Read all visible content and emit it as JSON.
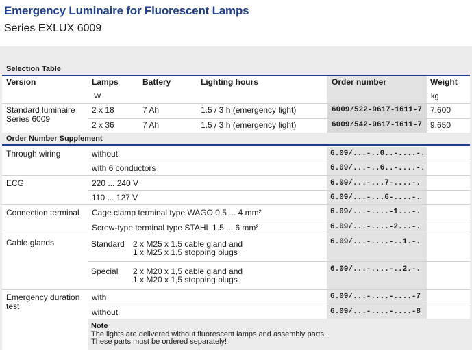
{
  "header": {
    "title": "Emergency Luminaire for Fluorescent Lamps",
    "subtitle": "Series EXLUX 6009"
  },
  "selection_table": {
    "title": "Selection Table",
    "columns": {
      "version": "Version",
      "lamps": "Lamps",
      "lamps_unit": "W",
      "battery": "Battery",
      "lighting_hours": "Lighting hours",
      "order_number": "Order number",
      "weight": "Weight",
      "weight_unit": "kg"
    },
    "version_line1": "Standard luminaire",
    "version_line2": "Series 6009",
    "rows": [
      {
        "lamps": "2 x 18",
        "battery": "7 Ah",
        "hours": "1.5 / 3 h (emergency light)",
        "order": "6009/522-9617-1611-7",
        "weight": "7.600"
      },
      {
        "lamps": "2 x 36",
        "battery": "7 Ah",
        "hours": "1.5 / 3 h (emergency light)",
        "order": "6009/542-9617-1611-7",
        "weight": "9.650"
      }
    ]
  },
  "supplement": {
    "title": "Order Number Supplement",
    "through_wiring": {
      "label": "Through wiring",
      "opt1": "without",
      "code1": "6.09/...-..0..-....-.",
      "opt2": "with 6 conductors",
      "code2": "6.09/...-..6..-....-."
    },
    "ecg": {
      "label": "ECG",
      "opt1": "220 ... 240 V",
      "code1": "6.09/...-...7-....-.",
      "opt2": "110 ... 127 V",
      "code2": "6.09/...-...6-....-."
    },
    "connection": {
      "label": "Connection terminal",
      "opt1": "Cage clamp terminal type WAGO 0.5 ... 4 mm²",
      "code1": "6.09/...-....-1...-.",
      "opt2": "Screw-type terminal type STAHL 1.5 ... 6 mm²",
      "code2": "6.09/...-....-2...-."
    },
    "glands": {
      "label": "Cable glands",
      "std_label": "Standard",
      "std_line1": "2 x M25 x 1.5 cable gland and",
      "std_line2": "1 x M25 x 1.5 stopping plugs",
      "std_code": "6.09/...-....-..1.-.",
      "sp_label": "Special",
      "sp_line1": "2 x M20 x 1,5 cable gland and",
      "sp_line2": "1 x M20 x 1,5 stopping plugs",
      "sp_code": "6.09/...-....-..2.-."
    },
    "emergency": {
      "label_line1": "Emergency duration",
      "label_line2": "test",
      "opt1": "with",
      "code1": "6.09/...-....-....-7",
      "opt2": "without",
      "code2": "6.09/...-....-....-8"
    }
  },
  "note": {
    "title": "Note",
    "line1": "The lights are delivered without fluorescent lamps and assembly parts.",
    "line2": "These parts must be ordered separately!"
  }
}
